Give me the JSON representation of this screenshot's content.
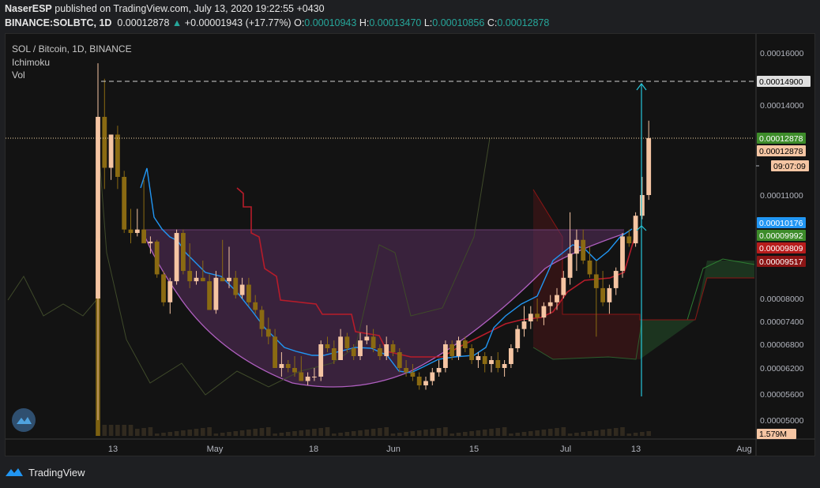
{
  "header": {
    "publisher": "NaserESP",
    "published_text": "published on TradingView.com, July 13, 2020 19:22:55 +0430"
  },
  "ohlc_bar": {
    "symbol": "BINANCE:SOLBTC, 1D",
    "last": "0.00012878",
    "arrow": "▲",
    "change": "+0.00001943 (+17.77%)",
    "o_label": "O:",
    "o": "0.00010943",
    "h_label": "H:",
    "h": "0.00013470",
    "l_label": "L:",
    "l": "0.00010856",
    "c_label": "C:",
    "c": "0.00012878"
  },
  "legend": {
    "title": "SOL / Bitcoin, 1D, BINANCE",
    "ind1": "Ichimoku",
    "ind2": "Vol"
  },
  "footer": {
    "brand": "TradingView"
  },
  "colors": {
    "up": "#f5c5a3",
    "down": "#8a6a12",
    "kijun": "#b71c2a",
    "tenkan": "#2196f3",
    "cloud_green": "#1e3b22",
    "cloud_red": "#3a1517",
    "bowl": "#5a2f5f",
    "bowl_line": "#b05fc0",
    "projection": "#26c6da"
  },
  "price_axis": {
    "ticks": [
      "0.00016000",
      "0.00014000",
      "0.00011000",
      "0.00008000",
      "0.00007400",
      "0.00006800",
      "0.00006200",
      "0.00005600",
      "0.00005000"
    ],
    "tags": [
      {
        "text": "0.00014900",
        "bg": "#e0e0e0",
        "fg": "#000000"
      },
      {
        "text": "0.00012878",
        "bg": "#3d8c2a",
        "fg": "#ffffff"
      },
      {
        "text": "0.00012878",
        "bg": "#f5c5a3",
        "fg": "#000000"
      },
      {
        "text": "09:07:09",
        "bg": "#f5c5a3",
        "fg": "#000000"
      },
      {
        "text": "0.00010176",
        "bg": "#2196f3",
        "fg": "#ffffff"
      },
      {
        "text": "0.00009992",
        "bg": "#3d8c2a",
        "fg": "#ffffff"
      },
      {
        "text": "0.00009809",
        "bg": "#b71c1c",
        "fg": "#ffffff"
      },
      {
        "text": "0.00009517",
        "bg": "#8b1515",
        "fg": "#ffffff"
      },
      {
        "text": "1.579M",
        "bg": "#f5c5a3",
        "fg": "#000000"
      }
    ]
  },
  "chart_data": {
    "type": "candlestick",
    "title": "SOL / Bitcoin, 1D, BINANCE",
    "x_ticks": [
      "13",
      "May",
      "18",
      "Jun",
      "15",
      "Jul",
      "13",
      "Aug"
    ],
    "ylim": [
      4.7e-05,
      0.00017
    ],
    "y_ticks": [
      0.00016,
      0.00014,
      0.00011,
      8e-05,
      7.4e-05,
      6.8e-05,
      6.2e-05,
      5.6e-05,
      5e-05
    ],
    "annotations": {
      "target": 0.000149,
      "last_price": 0.00012878,
      "tenkan_last": 0.00010176,
      "senkou_a": 9.992e-05,
      "kijun_last": 9.809e-05,
      "senkou_b": 9.517e-05,
      "volume_last": "1.579M",
      "countdown": "09:07:09"
    },
    "candles": [
      {
        "o": 8e-05,
        "h": 0.000156,
        "l": 5e-05,
        "c": 0.000136
      },
      {
        "o": 0.000136,
        "h": 0.00015,
        "l": 0.000112,
        "c": 0.000119
      },
      {
        "o": 0.000119,
        "h": 0.000129,
        "l": 0.000115,
        "c": 0.00013
      },
      {
        "o": 0.00013,
        "h": 0.000133,
        "l": 0.000112,
        "c": 0.000116
      },
      {
        "o": 0.000116,
        "h": 0.000118,
        "l": 9.9e-05,
        "c": 0.0001
      },
      {
        "o": 0.0001,
        "h": 0.000106,
        "l": 9.6e-05,
        "c": 9.9e-05
      },
      {
        "o": 9.9e-05,
        "h": 0.000106,
        "l": 9.8e-05,
        "c": 0.0001
      },
      {
        "o": 0.0001,
        "h": 0.000115,
        "l": 9.6e-05,
        "c": 9.6e-05
      },
      {
        "o": 9.6e-05,
        "h": 9.8e-05,
        "l": 9.3e-05,
        "c": 9.65e-05
      },
      {
        "o": 9.65e-05,
        "h": 9.7e-05,
        "l": 8.6e-05,
        "c": 8.7e-05
      },
      {
        "o": 8.7e-05,
        "h": 8.8e-05,
        "l": 7.8e-05,
        "c": 7.9e-05
      },
      {
        "o": 7.9e-05,
        "h": 8.6e-05,
        "l": 7.6e-05,
        "c": 8.5e-05
      },
      {
        "o": 8.5e-05,
        "h": 0.0001,
        "l": 8.4e-05,
        "c": 9.9e-05
      },
      {
        "o": 9.9e-05,
        "h": 0.0001,
        "l": 8.7e-05,
        "c": 8.8e-05
      },
      {
        "o": 8.8e-05,
        "h": 9.6e-05,
        "l": 8.3e-05,
        "c": 8.5e-05
      },
      {
        "o": 8.5e-05,
        "h": 8.8e-05,
        "l": 8.4e-05,
        "c": 8.6e-05
      },
      {
        "o": 8.6e-05,
        "h": 9.1e-05,
        "l": 8.5e-05,
        "c": 8.5e-05
      },
      {
        "o": 8.5e-05,
        "h": 8.7e-05,
        "l": 7.7e-05,
        "c": 7.7e-05
      },
      {
        "o": 7.7e-05,
        "h": 8.8e-05,
        "l": 7.6e-05,
        "c": 8.6e-05
      },
      {
        "o": 8.6e-05,
        "h": 9.7e-05,
        "l": 8.5e-05,
        "c": 8.5e-05
      },
      {
        "o": 8.5e-05,
        "h": 9.5e-05,
        "l": 8.3e-05,
        "c": 8.6e-05
      },
      {
        "o": 8.6e-05,
        "h": 8.8e-05,
        "l": 8e-05,
        "c": 8.1e-05
      },
      {
        "o": 8.1e-05,
        "h": 8.6e-05,
        "l": 8e-05,
        "c": 8.4e-05
      },
      {
        "o": 8.4e-05,
        "h": 8.6e-05,
        "l": 7.8e-05,
        "c": 7.9e-05
      },
      {
        "o": 7.9e-05,
        "h": 8.1e-05,
        "l": 7.6e-05,
        "c": 7.7e-05
      },
      {
        "o": 7.7e-05,
        "h": 7.8e-05,
        "l": 7e-05,
        "c": 7.2e-05
      },
      {
        "o": 7.2e-05,
        "h": 7.5e-05,
        "l": 6.8e-05,
        "c": 7e-05
      },
      {
        "o": 7e-05,
        "h": 7.2e-05,
        "l": 6.2e-05,
        "c": 6.2e-05
      },
      {
        "o": 6.2e-05,
        "h": 6.6e-05,
        "l": 6e-05,
        "c": 6.3e-05
      },
      {
        "o": 6.3e-05,
        "h": 6.4e-05,
        "l": 6.1e-05,
        "c": 6.2e-05
      },
      {
        "o": 6.2e-05,
        "h": 6.5e-05,
        "l": 6e-05,
        "c": 6.1e-05
      },
      {
        "o": 6.1e-05,
        "h": 6.5e-05,
        "l": 5.9e-05,
        "c": 5.9e-05
      },
      {
        "o": 5.9e-05,
        "h": 6.1e-05,
        "l": 5.8e-05,
        "c": 6e-05
      },
      {
        "o": 6e-05,
        "h": 6.2e-05,
        "l": 5.9e-05,
        "c": 6e-05
      },
      {
        "o": 6e-05,
        "h": 6.9e-05,
        "l": 5.9e-05,
        "c": 6.8e-05
      },
      {
        "o": 6.8e-05,
        "h": 7e-05,
        "l": 6.6e-05,
        "c": 6.7e-05
      },
      {
        "o": 6.7e-05,
        "h": 6.9e-05,
        "l": 6.3e-05,
        "c": 6.4e-05
      },
      {
        "o": 6.4e-05,
        "h": 7.2e-05,
        "l": 6.4e-05,
        "c": 7e-05
      },
      {
        "o": 7e-05,
        "h": 7.1e-05,
        "l": 6.6e-05,
        "c": 6.7e-05
      },
      {
        "o": 6.7e-05,
        "h": 6.8e-05,
        "l": 6.4e-05,
        "c": 6.5e-05
      },
      {
        "o": 6.5e-05,
        "h": 7.1e-05,
        "l": 6.4e-05,
        "c": 6.9e-05
      },
      {
        "o": 6.9e-05,
        "h": 7.3e-05,
        "l": 6.8e-05,
        "c": 7e-05
      },
      {
        "o": 7e-05,
        "h": 7.2e-05,
        "l": 6.6e-05,
        "c": 6.7e-05
      },
      {
        "o": 6.7e-05,
        "h": 6.8e-05,
        "l": 6.4e-05,
        "c": 6.5e-05
      },
      {
        "o": 6.5e-05,
        "h": 7e-05,
        "l": 6.4e-05,
        "c": 6.8e-05
      },
      {
        "o": 6.8e-05,
        "h": 6.9e-05,
        "l": 6.5e-05,
        "c": 6.6e-05
      },
      {
        "o": 6.6e-05,
        "h": 6.7e-05,
        "l": 6.1e-05,
        "c": 6.2e-05
      },
      {
        "o": 6.2e-05,
        "h": 6.4e-05,
        "l": 6e-05,
        "c": 6.1e-05
      },
      {
        "o": 6.1e-05,
        "h": 6.3e-05,
        "l": 5.9e-05,
        "c": 6e-05
      },
      {
        "o": 6e-05,
        "h": 6.1e-05,
        "l": 5.7e-05,
        "c": 5.8e-05
      },
      {
        "o": 5.8e-05,
        "h": 6e-05,
        "l": 5.7e-05,
        "c": 5.9e-05
      },
      {
        "o": 5.9e-05,
        "h": 6.2e-05,
        "l": 5.8e-05,
        "c": 6.1e-05
      },
      {
        "o": 6.1e-05,
        "h": 6.4e-05,
        "l": 6e-05,
        "c": 6.2e-05
      },
      {
        "o": 6.2e-05,
        "h": 6.9e-05,
        "l": 6.1e-05,
        "c": 6.8e-05
      },
      {
        "o": 6.8e-05,
        "h": 6.9e-05,
        "l": 6.4e-05,
        "c": 6.5e-05
      },
      {
        "o": 6.5e-05,
        "h": 7e-05,
        "l": 6.4e-05,
        "c": 6.9e-05
      },
      {
        "o": 6.9e-05,
        "h": 7e-05,
        "l": 6.6e-05,
        "c": 6.7e-05
      },
      {
        "o": 6.7e-05,
        "h": 6.8e-05,
        "l": 6.3e-05,
        "c": 6.4e-05
      },
      {
        "o": 6.4e-05,
        "h": 6.6e-05,
        "l": 6.2e-05,
        "c": 6.5e-05
      },
      {
        "o": 6.5e-05,
        "h": 6.6e-05,
        "l": 6.1e-05,
        "c": 6.3e-05
      },
      {
        "o": 6.3e-05,
        "h": 6.5e-05,
        "l": 6.1e-05,
        "c": 6.4e-05
      },
      {
        "o": 6.4e-05,
        "h": 6.6e-05,
        "l": 6.1e-05,
        "c": 6.2e-05
      },
      {
        "o": 6.2e-05,
        "h": 6.4e-05,
        "l": 6e-05,
        "c": 6.3e-05
      },
      {
        "o": 6.3e-05,
        "h": 6.8e-05,
        "l": 6.2e-05,
        "c": 6.7e-05
      },
      {
        "o": 6.7e-05,
        "h": 7.3e-05,
        "l": 6.6e-05,
        "c": 7.2e-05
      },
      {
        "o": 7.2e-05,
        "h": 7.8e-05,
        "l": 7e-05,
        "c": 7.4e-05
      },
      {
        "o": 7.4e-05,
        "h": 7.8e-05,
        "l": 7.2e-05,
        "c": 7.6e-05
      },
      {
        "o": 7.6e-05,
        "h": 8e-05,
        "l": 7.4e-05,
        "c": 7.5e-05
      },
      {
        "o": 7.5e-05,
        "h": 7.9e-05,
        "l": 7.3e-05,
        "c": 7.8e-05
      },
      {
        "o": 7.8e-05,
        "h": 8.1e-05,
        "l": 7.6e-05,
        "c": 7.9e-05
      },
      {
        "o": 7.9e-05,
        "h": 8.3e-05,
        "l": 7.7e-05,
        "c": 8.1e-05
      },
      {
        "o": 8.1e-05,
        "h": 8.8e-05,
        "l": 8e-05,
        "c": 8.6e-05
      },
      {
        "o": 8.6e-05,
        "h": 0.000105,
        "l": 8.4e-05,
        "c": 9.3e-05
      },
      {
        "o": 9.3e-05,
        "h": 0.0001,
        "l": 8.8e-05,
        "c": 9.7e-05
      },
      {
        "o": 9.7e-05,
        "h": 0.0001,
        "l": 9e-05,
        "c": 9.1e-05
      },
      {
        "o": 9.1e-05,
        "h": 9.5e-05,
        "l": 8.6e-05,
        "c": 8.7e-05
      },
      {
        "o": 8.7e-05,
        "h": 9.1e-05,
        "l": 7e-05,
        "c": 8.3e-05
      },
      {
        "o": 8.3e-05,
        "h": 8.8e-05,
        "l": 7.8e-05,
        "c": 7.9e-05
      },
      {
        "o": 7.9e-05,
        "h": 8.4e-05,
        "l": 7.6e-05,
        "c": 8.3e-05
      },
      {
        "o": 8.3e-05,
        "h": 8.9e-05,
        "l": 8.1e-05,
        "c": 8.8e-05
      },
      {
        "o": 8.8e-05,
        "h": 9.9e-05,
        "l": 8.6e-05,
        "c": 9.8e-05
      },
      {
        "o": 9.8e-05,
        "h": 0.0001,
        "l": 9.5e-05,
        "c": 9.6e-05
      },
      {
        "o": 9.6e-05,
        "h": 0.000105,
        "l": 9.5e-05,
        "c": 0.000104
      },
      {
        "o": 0.000104,
        "h": 0.000116,
        "l": 0.000103,
        "c": 0.00011
      },
      {
        "o": 0.00011,
        "h": 0.0001347,
        "l": 0.0001086,
        "c": 0.0001288
      }
    ]
  }
}
